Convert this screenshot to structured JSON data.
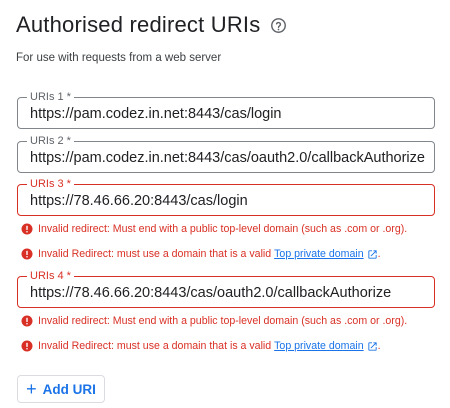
{
  "section": {
    "title": "Authorised redirect URIs",
    "subtitle": "For use with requests from a web server"
  },
  "icons": {
    "help": "help-circle-icon",
    "error": "error-circle-icon",
    "external": "open-in-new-icon",
    "add": "plus-icon"
  },
  "colors": {
    "error": "#d93025",
    "link": "#1a73e8",
    "border": "#80868b"
  },
  "uris": [
    {
      "label": "URIs 1 *",
      "value": "https://pam.codez.in.net:8443/cas/login",
      "has_error": false
    },
    {
      "label": "URIs 2 *",
      "value": "https://pam.codez.in.net:8443/cas/oauth2.0/callbackAuthorize",
      "has_error": false
    },
    {
      "label": "URIs 3 *",
      "value": "https://78.46.66.20:8443/cas/login",
      "has_error": true,
      "error_1": "Invalid redirect: Must end with a public top-level domain (such as .com or .org).",
      "error_2_prefix": "Invalid Redirect: must use a domain that is a valid ",
      "error_2_link": "Top private domain",
      "error_2_suffix": "."
    },
    {
      "label": "URIs 4 *",
      "value": "https://78.46.66.20:8443/cas/oauth2.0/callbackAuthorize",
      "has_error": true,
      "error_1": "Invalid redirect: Must end with a public top-level domain (such as .com or .org).",
      "error_2_prefix": "Invalid Redirect: must use a domain that is a valid ",
      "error_2_link": "Top private domain",
      "error_2_suffix": "."
    }
  ],
  "add_button": {
    "label": "Add URI",
    "icon": "+"
  }
}
